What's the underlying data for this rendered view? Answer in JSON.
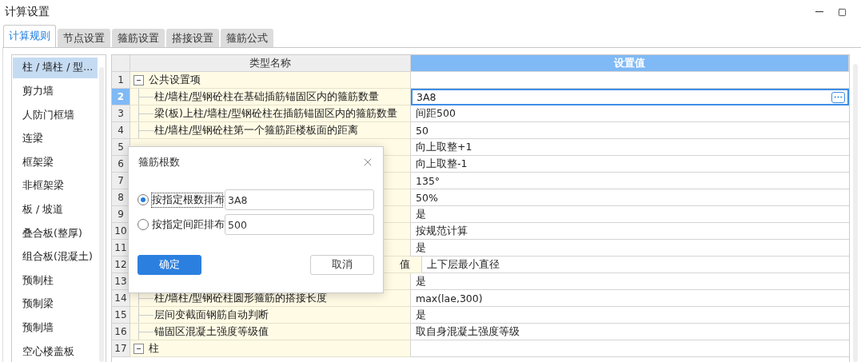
{
  "window": {
    "title": "计算设置"
  },
  "tabs": [
    {
      "label": "计算规则",
      "selected": true
    },
    {
      "label": "节点设置",
      "selected": false
    },
    {
      "label": "箍筋设置",
      "selected": false
    },
    {
      "label": "搭接设置",
      "selected": false
    },
    {
      "label": "箍筋公式",
      "selected": false
    }
  ],
  "sidebar": {
    "items": [
      {
        "label": "柱 / 墙柱 / 型...",
        "selected": true
      },
      {
        "label": "剪力墙",
        "selected": false
      },
      {
        "label": "人防门框墙",
        "selected": false
      },
      {
        "label": "连梁",
        "selected": false
      },
      {
        "label": "框架梁",
        "selected": false
      },
      {
        "label": "非框架梁",
        "selected": false
      },
      {
        "label": "板 / 坡道",
        "selected": false
      },
      {
        "label": "叠合板(整厚)",
        "selected": false
      },
      {
        "label": "组合板(混凝土)",
        "selected": false
      },
      {
        "label": "预制柱",
        "selected": false
      },
      {
        "label": "预制梁",
        "selected": false
      },
      {
        "label": "预制墙",
        "selected": false
      },
      {
        "label": "空心楼盖板",
        "selected": false
      }
    ]
  },
  "table": {
    "columns": [
      "类型名称",
      "设置值"
    ],
    "rows": [
      {
        "number": "1",
        "kind": "group",
        "name": "公共设置项",
        "expanded": true,
        "selected": false
      },
      {
        "number": "2",
        "kind": "item",
        "name": "柱/墙柱/型钢砼柱在基础插筋锚固区内的箍筋数量",
        "value": "3A8",
        "selected": true
      },
      {
        "number": "3",
        "kind": "item",
        "name": "梁(板)上柱/墙柱/型钢砼柱在插筋锚固区内的箍筋数量",
        "value": "间距500",
        "selected": false
      },
      {
        "number": "4",
        "kind": "item",
        "name": "柱/墙柱/型钢砼柱第一个箍筋距楼板面的距离",
        "value": "50",
        "selected": false
      },
      {
        "number": "5",
        "kind": "item",
        "value": "向上取整+1",
        "selected": false
      },
      {
        "number": "6",
        "kind": "item",
        "value": "向上取整-1",
        "selected": false
      },
      {
        "number": "7",
        "kind": "item",
        "value": "135°",
        "selected": false
      },
      {
        "number": "8",
        "kind": "item",
        "value": "50%",
        "selected": false
      },
      {
        "number": "9",
        "kind": "item",
        "value": "是",
        "selected": false
      },
      {
        "number": "10",
        "kind": "item",
        "value": "按规范计算",
        "selected": false
      },
      {
        "number": "11",
        "kind": "item",
        "value": "是",
        "selected": false
      },
      {
        "number": "12",
        "kind": "item",
        "name": "值",
        "name_cut_start": true,
        "value": "上下层最小直径",
        "selected": false
      },
      {
        "number": "13",
        "kind": "item",
        "value": "是",
        "selected": false
      },
      {
        "number": "14",
        "kind": "item",
        "name": "柱/墙柱/型钢砼柱圆形箍筋的搭接长度",
        "value": "max(lae,300)",
        "selected": false
      },
      {
        "number": "15",
        "kind": "item",
        "name": "层间变截面钢筋自动判断",
        "value": "是",
        "selected": false
      },
      {
        "number": "16",
        "kind": "item",
        "name": "锚固区混凝土强度等级值",
        "value": "取自身混凝土强度等级",
        "selected": false
      },
      {
        "number": "17",
        "kind": "group",
        "name": "柱",
        "expanded": true,
        "selected": false
      }
    ]
  },
  "dialog": {
    "title": "箍筋根数",
    "options": [
      {
        "label": "按指定根数排布",
        "value": "3A8",
        "selected": true
      },
      {
        "label": "按指定间距排布",
        "value": "500",
        "selected": false
      }
    ],
    "buttons": [
      {
        "label": "确定",
        "kind": "primary"
      },
      {
        "label": "取消",
        "kind": "secondary"
      }
    ]
  }
}
